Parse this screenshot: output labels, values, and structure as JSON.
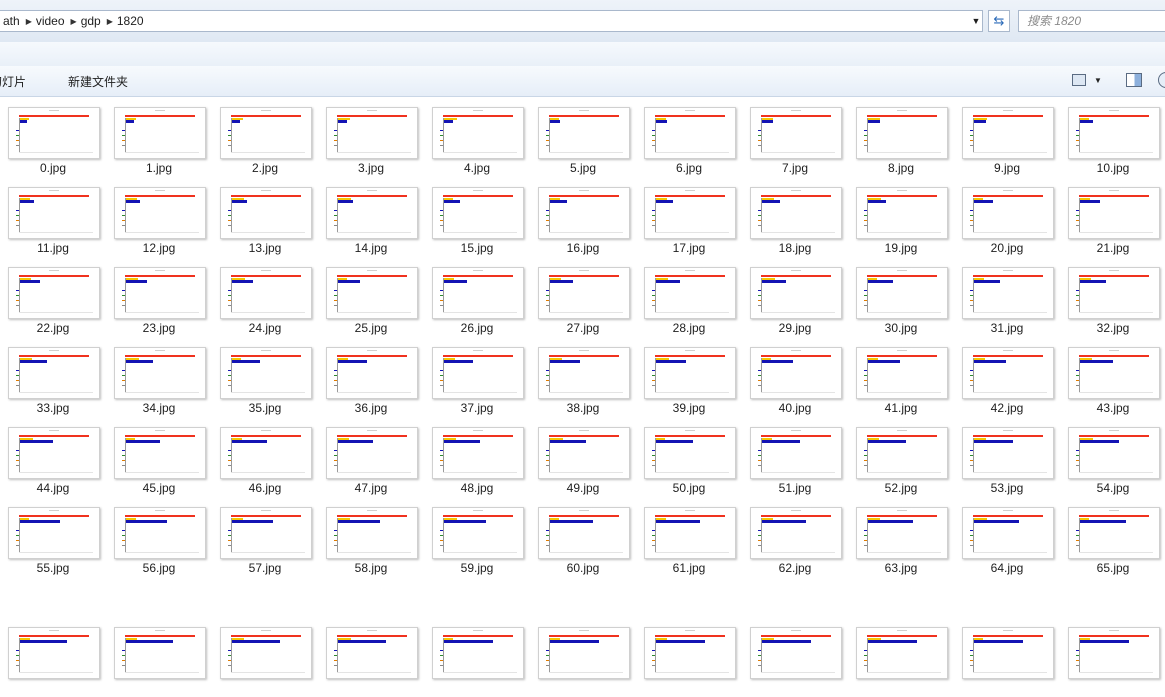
{
  "address_bar": {
    "crumbs": [
      "ath",
      "video",
      "gdp",
      "1820"
    ]
  },
  "search": {
    "placeholder": "搜索 1820"
  },
  "toolbar": {
    "slideshow_label": "放幻灯片",
    "new_folder_label": "新建文件夹"
  },
  "files": [
    "0.jpg",
    "1.jpg",
    "2.jpg",
    "3.jpg",
    "4.jpg",
    "5.jpg",
    "6.jpg",
    "7.jpg",
    "8.jpg",
    "9.jpg",
    "10.jpg",
    "11.jpg",
    "12.jpg",
    "13.jpg",
    "14.jpg",
    "15.jpg",
    "16.jpg",
    "17.jpg",
    "18.jpg",
    "19.jpg",
    "20.jpg",
    "21.jpg",
    "22.jpg",
    "23.jpg",
    "24.jpg",
    "25.jpg",
    "26.jpg",
    "27.jpg",
    "28.jpg",
    "29.jpg",
    "30.jpg",
    "31.jpg",
    "32.jpg",
    "33.jpg",
    "34.jpg",
    "35.jpg",
    "36.jpg",
    "37.jpg",
    "38.jpg",
    "39.jpg",
    "40.jpg",
    "41.jpg",
    "42.jpg",
    "43.jpg",
    "44.jpg",
    "45.jpg",
    "46.jpg",
    "47.jpg",
    "48.jpg",
    "49.jpg",
    "50.jpg",
    "51.jpg",
    "52.jpg",
    "53.jpg",
    "54.jpg",
    "55.jpg",
    "56.jpg",
    "57.jpg",
    "58.jpg",
    "59.jpg",
    "60.jpg",
    "61.jpg",
    "62.jpg",
    "63.jpg",
    "64.jpg",
    "65.jpg",
    "",
    "",
    "",
    "",
    "",
    "",
    "",
    "",
    "",
    "",
    ""
  ],
  "colors": {
    "thumb_line": "#f0321e",
    "thumb_bar": "#1414b4",
    "thumb_yellow": "#f7c600"
  },
  "icons": {
    "refresh": "refresh-icon",
    "view": "view-mode-icon",
    "pane": "preview-pane-icon"
  }
}
